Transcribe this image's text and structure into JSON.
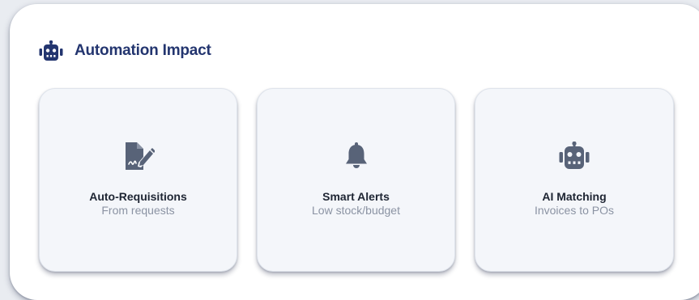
{
  "header": {
    "title": "Automation Impact",
    "icon": "robot-icon",
    "accent_color": "#23356f"
  },
  "cards": [
    {
      "icon": "file-signature-icon",
      "title": "Auto-Requisitions",
      "subtitle": "From requests"
    },
    {
      "icon": "bell-icon",
      "title": "Smart Alerts",
      "subtitle": "Low stock/budget"
    },
    {
      "icon": "robot-icon",
      "title": "AI Matching",
      "subtitle": "Invoices to POs"
    }
  ],
  "colors": {
    "icon_gray": "#586378",
    "card_bg": "#f4f6fa",
    "title_text": "#1e2533",
    "subtitle_text": "#8b93a3"
  }
}
